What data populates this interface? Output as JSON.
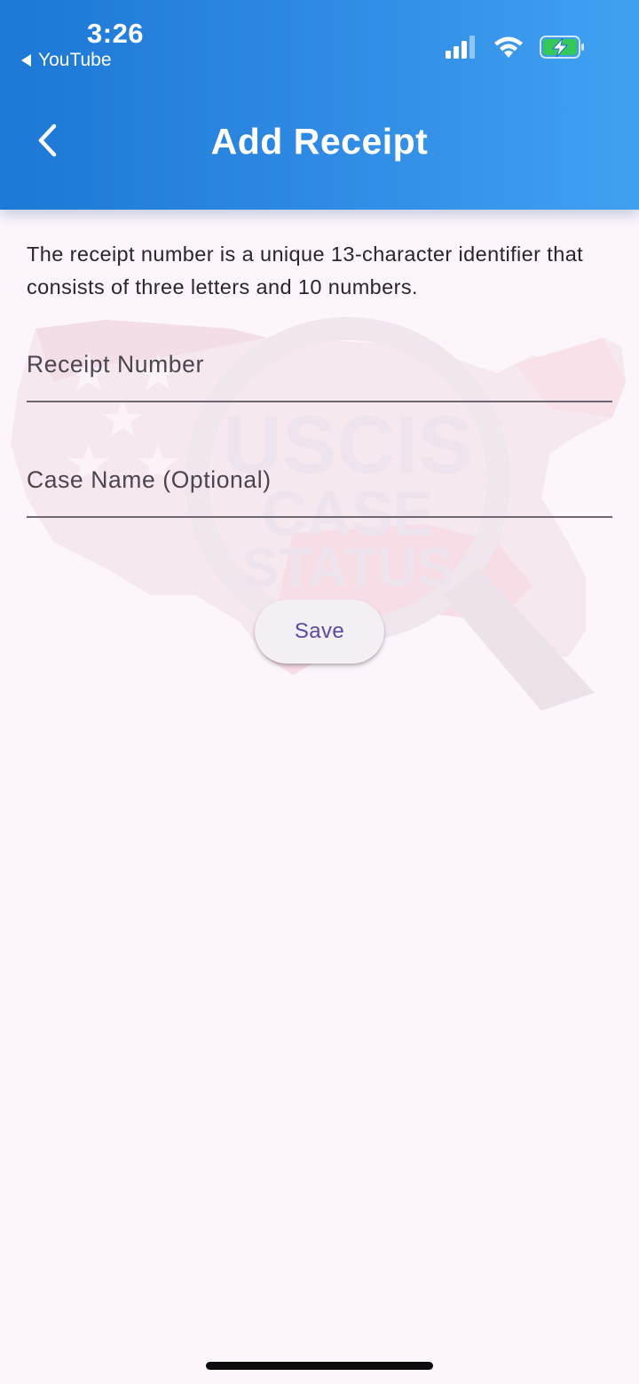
{
  "status_bar": {
    "time": "3:26",
    "back_app": "YouTube",
    "icons": [
      "cellular-signal-icon",
      "wifi-icon",
      "battery-charging-icon"
    ]
  },
  "header": {
    "title": "Add Receipt",
    "back_icon": "chevron-left-icon"
  },
  "description": "The receipt number is a unique 13-character identifier that consists of three letters and 10 numbers.",
  "form": {
    "receipt_number_placeholder": "Receipt Number",
    "receipt_number_value": "",
    "case_name_placeholder": "Case Name (Optional)",
    "case_name_value": "",
    "save_label": "Save"
  },
  "watermark": {
    "line1": "USCIS",
    "line2": "CASE",
    "line3": "STATUS"
  },
  "colors": {
    "header_start": "#1d78d6",
    "header_end": "#40a1f2",
    "background": "#fcf5fc",
    "save_text": "#5b4aa0",
    "battery": "#34c759"
  }
}
